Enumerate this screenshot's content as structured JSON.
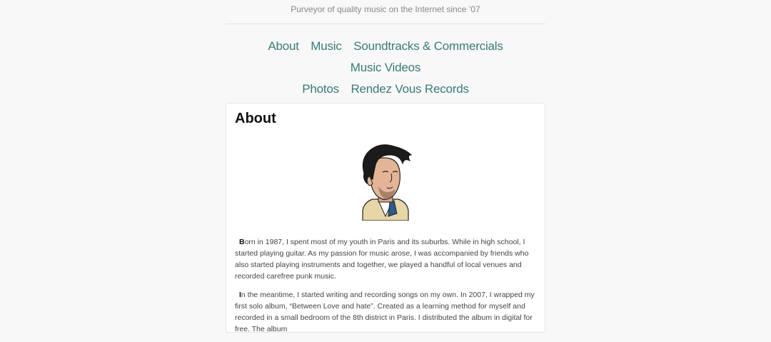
{
  "header": {
    "tagline": "Purveyor of quality music on the Internet since ’07"
  },
  "nav": {
    "items": [
      {
        "label": "About"
      },
      {
        "label": "Music"
      },
      {
        "label": "Soundtracks & Commercials"
      },
      {
        "label": "Music Videos"
      },
      {
        "label": "Photos"
      },
      {
        "label": "Rendez Vous Records"
      }
    ]
  },
  "colors": {
    "accent": "#3a7a78",
    "background": "#f8f8f8"
  },
  "about": {
    "title": "About",
    "paragraphs": [
      {
        "initial": "B",
        "text": "orn in 1987, I spent most of my youth in Paris and its suburbs. While in high school, I started playing guitar. As my passion for music arose, I was accompanied by friends who also started playing instruments and together, we played a handful of local venues and recorded carefree punk music."
      },
      {
        "initial": "I",
        "text": "n the meantime, I started writing and recording songs on my own. In 2007, I wrapped my first solo album, “Between Love and hate”. Created as a learning method for myself and recorded in a small bedroom of the 8th district in Paris. I distributed the album in digital for free. The album"
      }
    ]
  }
}
